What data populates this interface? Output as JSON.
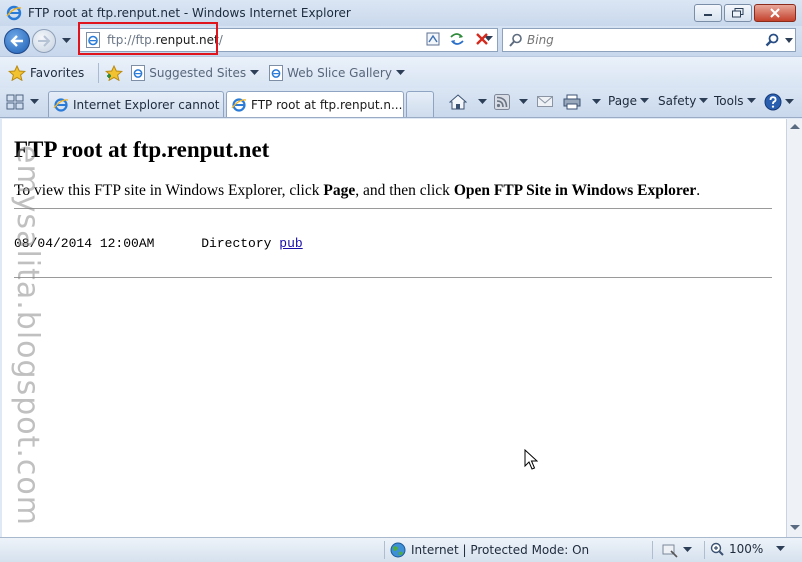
{
  "window": {
    "title": "FTP root at ftp.renput.net - Windows Internet Explorer"
  },
  "address": {
    "url_prefix": "ftp://ftp.",
    "url_domain": "renput.net",
    "url_suffix": "/"
  },
  "search": {
    "placeholder": "Bing"
  },
  "favorites_bar": {
    "favorites_label": "Favorites",
    "suggested_sites_label": "Suggested Sites",
    "web_slice_label": "Web Slice Gallery"
  },
  "tabs": [
    {
      "label": "Internet Explorer cannot di..."
    },
    {
      "label": "FTP root at ftp.renput.n..."
    }
  ],
  "command_bar": {
    "page_label": "Page",
    "safety_label": "Safety",
    "tools_label": "Tools"
  },
  "page": {
    "heading": "FTP root at ftp.renput.net",
    "instruction_prefix": "To view this FTP site in Windows Explorer, click ",
    "instruction_page": "Page",
    "instruction_middle": ", and then click ",
    "instruction_action": "Open FTP Site in Windows Explorer",
    "instruction_end": ".",
    "listing": {
      "date": "08/04/2014 12:00AM",
      "type": "Directory",
      "name": "pub"
    }
  },
  "watermark": "emysalita.blogspot.com",
  "status": {
    "zone_text": "Internet | Protected Mode: On",
    "zoom": "100%"
  },
  "colors": {
    "highlight_box": "#e0141c",
    "link": "#1a0dab"
  }
}
